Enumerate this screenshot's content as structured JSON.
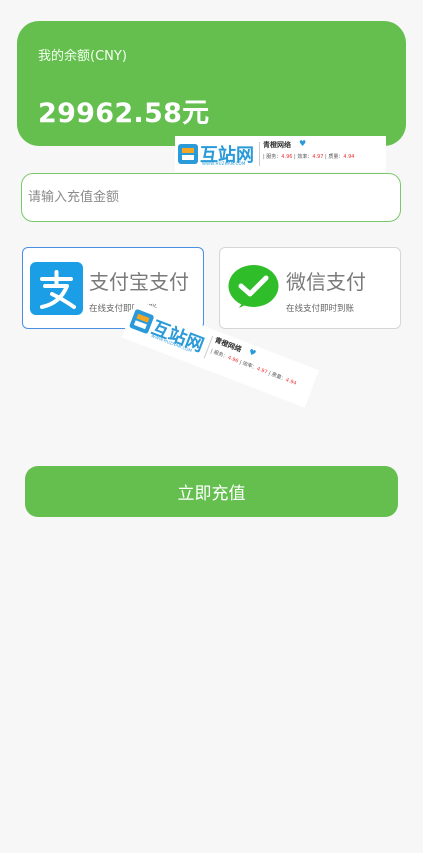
{
  "balance": {
    "label": "我的余额(CNY)",
    "amount": "29962.58元"
  },
  "recharge_input": {
    "placeholder": "请输入充值金额",
    "value": ""
  },
  "payment_methods": [
    {
      "name": "支付宝支付",
      "desc": "在线支付即时到账",
      "icon": "alipay-icon",
      "selected": true
    },
    {
      "name": "微信支付",
      "desc": "在线支付即时到账",
      "icon": "wechat-pay-icon",
      "selected": false
    }
  ],
  "submit_label": "立即充值",
  "watermark": {
    "logo_text": "互站网",
    "logo_sub": "WWW.HUZHAN.COM",
    "shop_name": "青橙网络",
    "scores": [
      {
        "label": "服务：",
        "value": "4.96"
      },
      {
        "label": "效率：",
        "value": "4.97"
      },
      {
        "label": "质量：",
        "value": "4.94"
      }
    ]
  },
  "colors": {
    "primary": "#64bf4f",
    "alipay": "#1b9ee5",
    "wechat": "#2fbd2a",
    "selected_border": "#4a90e2",
    "background": "#f7f7f7"
  }
}
